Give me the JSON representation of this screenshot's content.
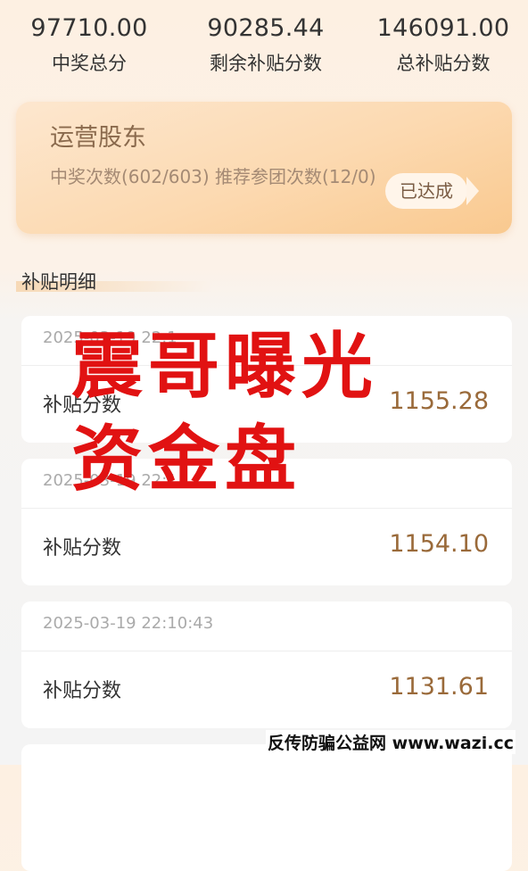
{
  "stats": [
    {
      "value": "97710.00",
      "label": "中奖总分"
    },
    {
      "value": "90285.44",
      "label": "剩余补贴分数"
    },
    {
      "value": "146091.00",
      "label": "总补贴分数"
    }
  ],
  "operator_card": {
    "title": "运营股东",
    "desc": "中奖次数(602/603) 推荐参团次数(12/0)",
    "badge": "已达成"
  },
  "section": {
    "title": "补贴明细"
  },
  "records": [
    {
      "time": "2025-03-19 22:1",
      "label": "补贴分数",
      "value": "1155.28"
    },
    {
      "time": "2025-03-19 22:1",
      "label": "补贴分数",
      "value": "1154.10"
    },
    {
      "time": "2025-03-19 22:10:43",
      "label": "补贴分数",
      "value": "1131.61"
    }
  ],
  "overlay": {
    "line1": "震哥曝光",
    "line2": "资金盘"
  },
  "watermark": "反传防骗公益网 www.wazi.cc"
}
